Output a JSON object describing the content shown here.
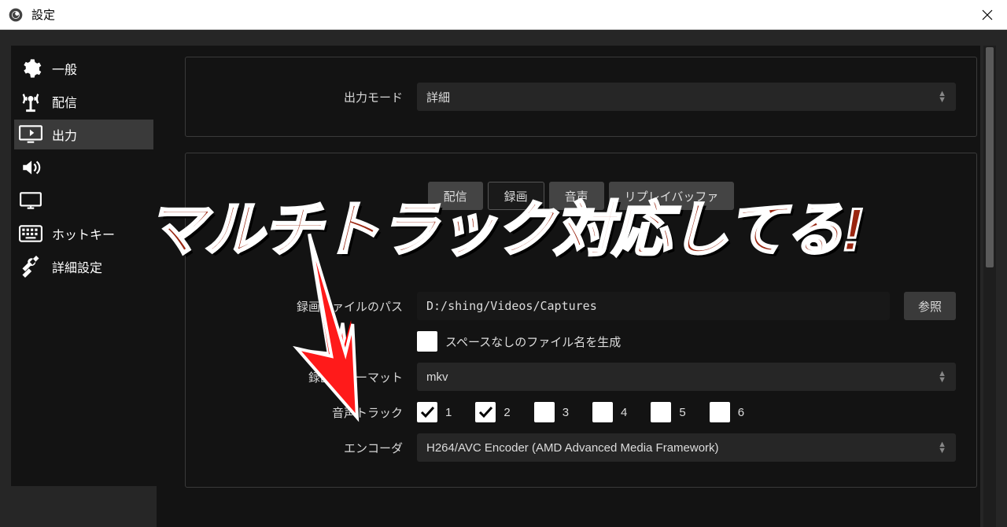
{
  "window": {
    "title": "設定"
  },
  "sidebar": {
    "items": [
      {
        "label": "一般",
        "icon": "gear"
      },
      {
        "label": "配信",
        "icon": "broadcast"
      },
      {
        "label": "出力",
        "icon": "output",
        "active": true
      },
      {
        "label": "",
        "icon": "audio"
      },
      {
        "label": "",
        "icon": "video"
      },
      {
        "label": "ホットキー",
        "icon": "keyboard"
      },
      {
        "label": "詳細設定",
        "icon": "tools"
      }
    ]
  },
  "main": {
    "output_mode_label": "出力モード",
    "output_mode_value": "詳細",
    "tabs": [
      {
        "label": "配信",
        "active": false
      },
      {
        "label": "録画",
        "active": true
      },
      {
        "label": "音声",
        "active": false
      },
      {
        "label": "リプレイバッファ",
        "active": false
      }
    ],
    "recording_path_label": "録画ファイルのパス",
    "recording_path_value": "D:/shing/Videos/Captures",
    "browse_label": "参照",
    "no_space_filename_label": "スペースなしのファイル名を生成",
    "recording_format_label": "録画フォーマット",
    "recording_format_value": "mkv",
    "audio_track_label": "音声トラック",
    "audio_tracks": [
      {
        "num": "1",
        "checked": true
      },
      {
        "num": "2",
        "checked": true
      },
      {
        "num": "3",
        "checked": false
      },
      {
        "num": "4",
        "checked": false
      },
      {
        "num": "5",
        "checked": false
      },
      {
        "num": "6",
        "checked": false
      }
    ],
    "encoder_label": "エンコーダ",
    "encoder_value": "H264/AVC Encoder (AMD Advanced Media Framework)"
  },
  "overlay": {
    "text": "マルチトラック対応してる!"
  }
}
